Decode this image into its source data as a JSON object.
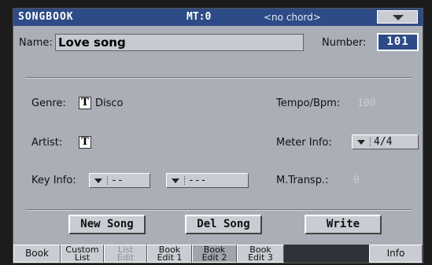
{
  "header": {
    "page_title": "SONGBOOK",
    "mt": "MT:0",
    "chord": "<no chord>",
    "menu_icon": "chevron-down-icon"
  },
  "name": {
    "label": "Name:",
    "value": "Love song"
  },
  "number": {
    "label": "Number:",
    "value": "101"
  },
  "genre": {
    "label": "Genre:",
    "icon": "T",
    "value": "Disco"
  },
  "artist": {
    "label": "Artist:",
    "icon": "T"
  },
  "key_info": {
    "label": "Key Info:",
    "select1": "--",
    "select2": "---"
  },
  "tempo": {
    "label": "Tempo/Bpm:",
    "value": "100"
  },
  "meter": {
    "label": "Meter Info:",
    "value": "4/4"
  },
  "transp": {
    "label": "M.Transp.:",
    "value": "0"
  },
  "buttons": {
    "new_song": "New Song",
    "del_song": "Del Song",
    "write": "Write"
  },
  "tabs": [
    {
      "line1": "Book",
      "line2": ""
    },
    {
      "line1": "Custom",
      "line2": "List"
    },
    {
      "line1": "List",
      "line2": "Edit"
    },
    {
      "line1": "Book",
      "line2": "Edit 1"
    },
    {
      "line1": "Book",
      "line2": "Edit 2"
    },
    {
      "line1": "Book",
      "line2": "Edit 3"
    },
    {
      "line1": "Info",
      "line2": ""
    }
  ],
  "colors": {
    "title_bar": "#2d4b86",
    "panel": "#a9aeb7",
    "selected_tab": "#9fa4ad"
  }
}
